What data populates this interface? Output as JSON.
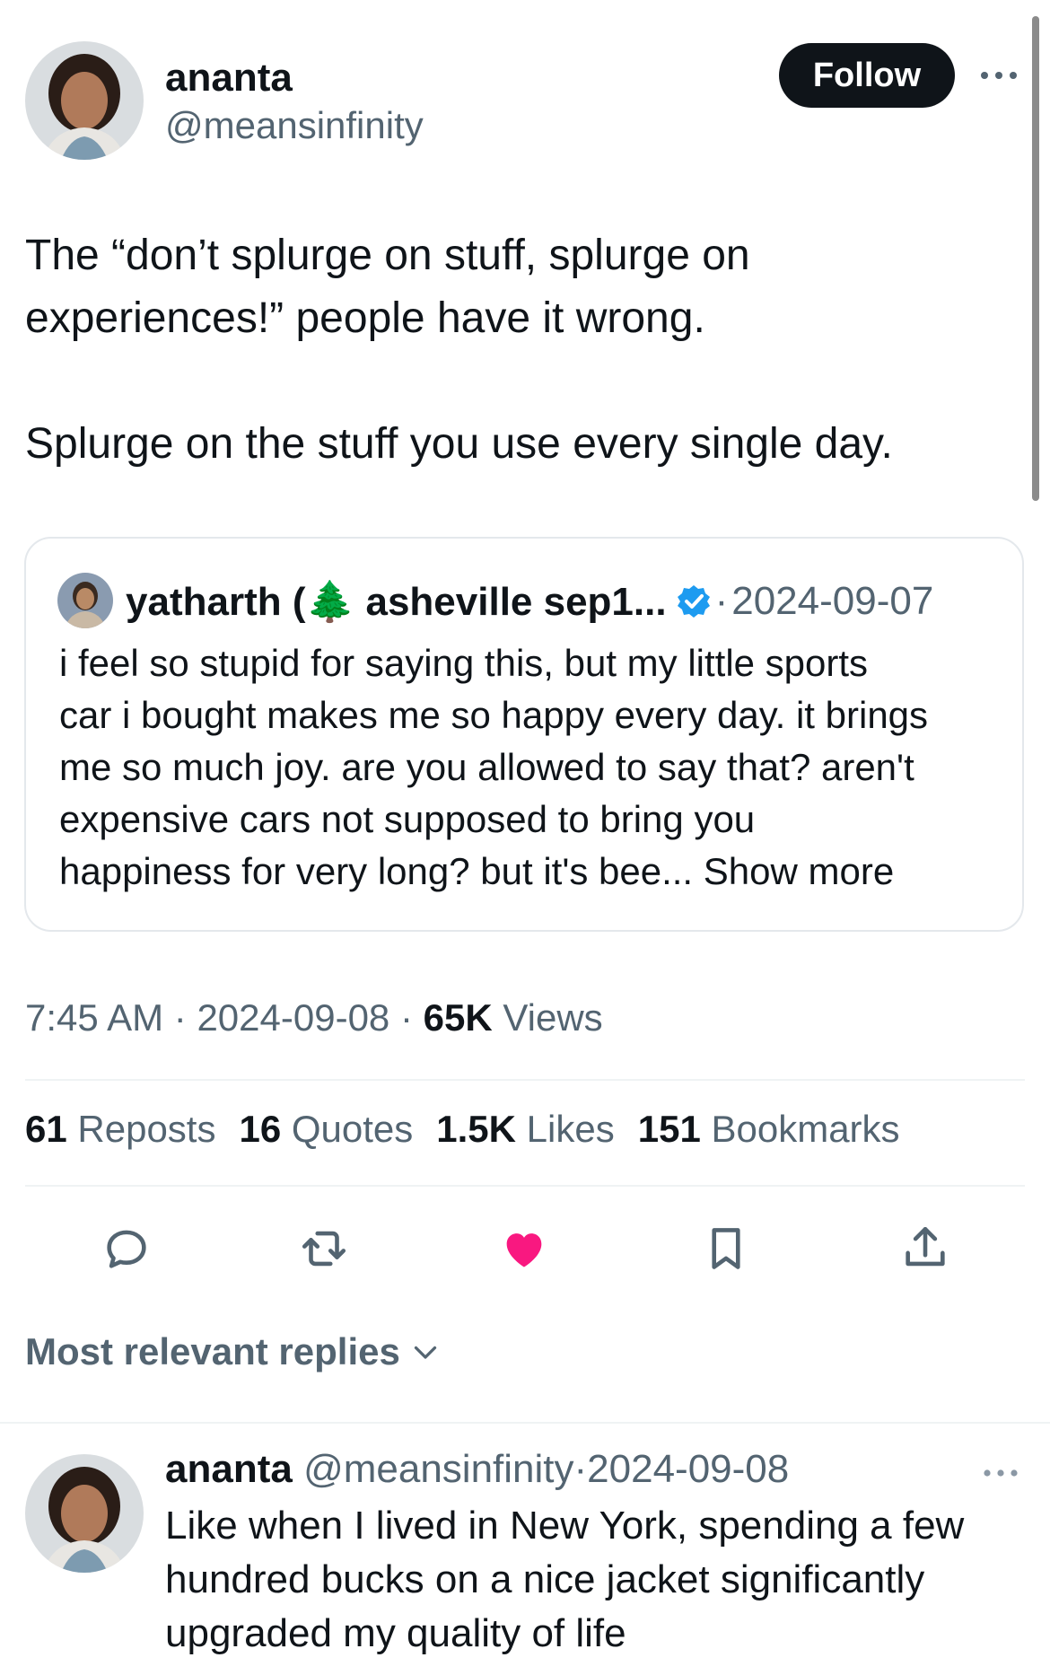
{
  "tweet": {
    "author": {
      "name": "ananta",
      "handle": "@meansinfinity"
    },
    "follow_label": "Follow",
    "text_lines": [
      "The “don’t splurge on stuff, splurge on",
      "experiences!” people have it wrong.",
      "Splurge on the stuff you use every single day."
    ],
    "quoted": {
      "name": "yatharth (🌲 asheville sep1...",
      "date": "2024-09-07",
      "separator": "·",
      "lines": [
        "i feel so stupid for saying this, but my little sports",
        "car i bought makes me so happy every day. it brings",
        "me so much joy. are you allowed to say that? aren't",
        "expensive cars not supposed to bring you",
        "happiness for very long? but it's bee..."
      ],
      "show_more": "Show more"
    },
    "meta": {
      "time": "7:45 AM",
      "date": "2024-09-08",
      "views_count": "65K",
      "views_label": "Views",
      "sep": "·"
    },
    "stats": [
      {
        "count": "61",
        "label": "Reposts"
      },
      {
        "count": "16",
        "label": "Quotes"
      },
      {
        "count": "1.5K",
        "label": "Likes"
      },
      {
        "count": "151",
        "label": "Bookmarks"
      }
    ],
    "actions": [
      "reply-icon",
      "repost-icon",
      "like-icon",
      "bookmark-icon",
      "share-icon"
    ],
    "like_color": "#f91880"
  },
  "replies_sort_label": "Most relevant replies",
  "reply": {
    "name": "ananta",
    "handle": "@meansinfinity",
    "sep": "·",
    "date": "2024-09-08",
    "lines": [
      "Like when I lived in New York, spending a few",
      "hundred bucks on a nice jacket significantly",
      "upgraded my quality of life"
    ]
  }
}
